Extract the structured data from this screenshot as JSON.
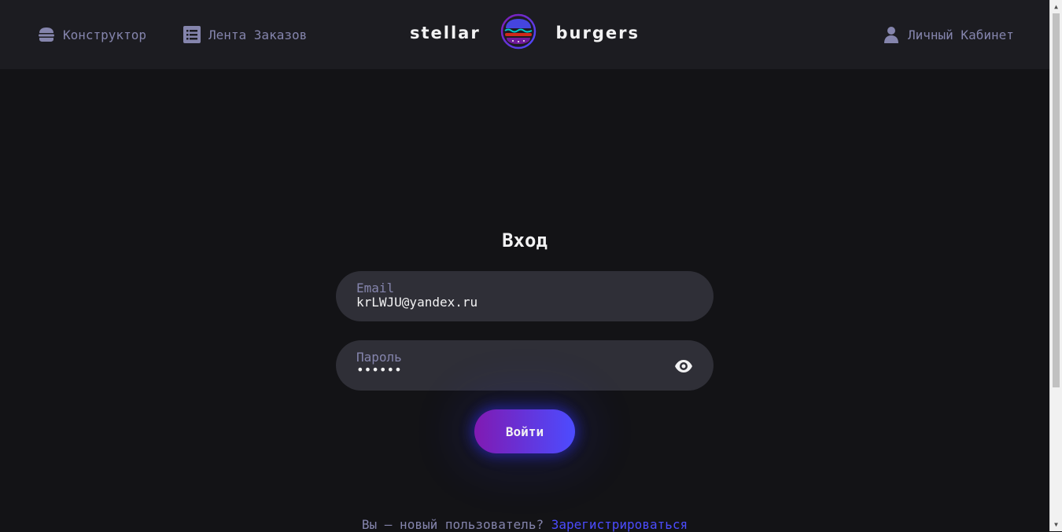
{
  "header": {
    "nav": {
      "constructor_label": "Конструктор",
      "feed_label": "Лента Заказов",
      "account_label": "Личный Кабинет"
    },
    "logo": {
      "left_word": "stellar",
      "right_word": "burgers"
    }
  },
  "login": {
    "title": "Вход",
    "email_label": "Email",
    "email_value": "krLWJU@yandex.ru",
    "password_label": "Пароль",
    "password_value": "••••••",
    "submit_label": "Войти",
    "register_prompt": "Вы — новый пользователь?",
    "register_link": "Зарегистрироваться"
  },
  "colors": {
    "background": "#131316",
    "header": "#1c1c21",
    "field": "#2f2f37",
    "muted_text": "#8585ad",
    "accent": "#4c4cff",
    "button_gradient_start": "#801ab2"
  }
}
